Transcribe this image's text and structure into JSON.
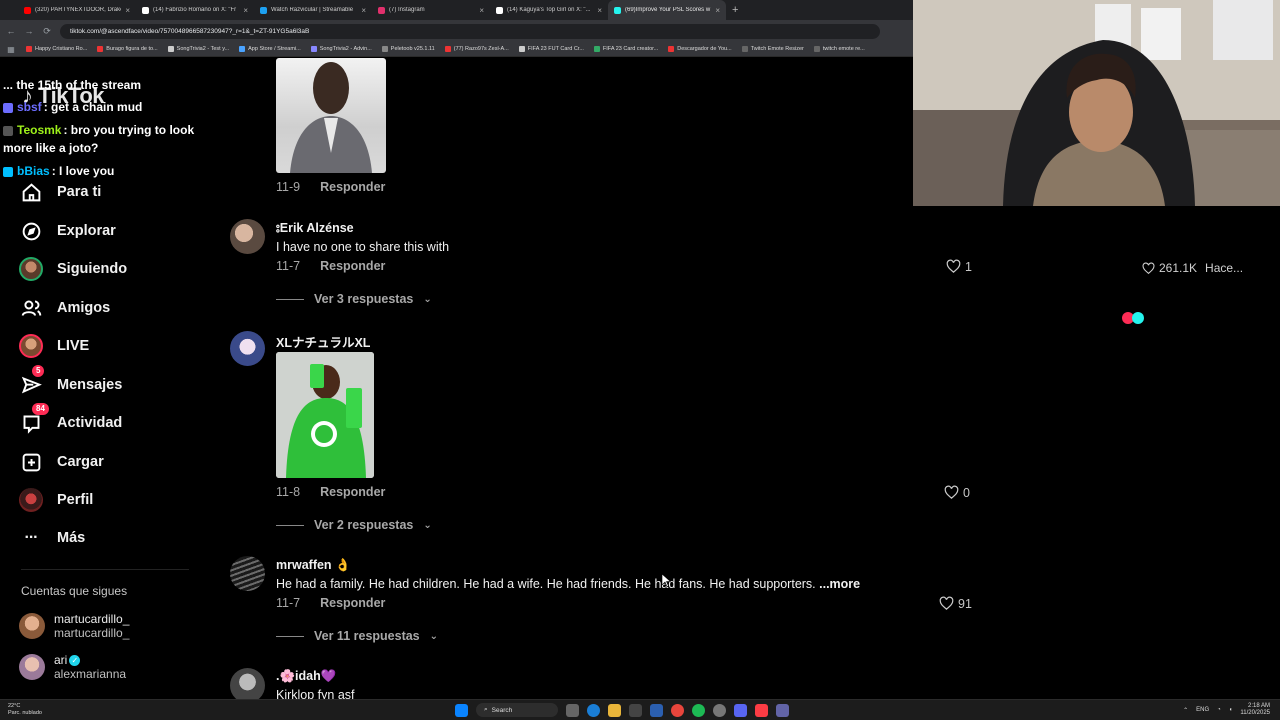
{
  "browser": {
    "tabs": [
      {
        "title": "(320) PARTYNEXTDOOR, Drake",
        "color": "#ff0000"
      },
      {
        "title": "(14) Fabrizio Romano on X: \"Fr",
        "color": "#ffffff"
      },
      {
        "title": "Watch Razvicular | Streamable",
        "color": "#1da1f2"
      },
      {
        "title": "(7) Instagram",
        "color": "#e1306c"
      },
      {
        "title": "(14) Kaguya's Top Girl on X: \"...",
        "color": "#ffffff"
      },
      {
        "title": "(69)Improve Your PSL Scores w",
        "color": "#25f4ee",
        "active": true
      }
    ],
    "new_tab": "+",
    "url": "tiktok.com/@ascendface/video/7570048966587230947?_r=1&_t=ZT-91YG5a6l3aB",
    "bookmarks": [
      "Happy Cristiano Ro...",
      "Burago figura de to...",
      "SongTrivia2 - Test y...",
      "App Store / Streami...",
      "SongTrivia2 - Advin...",
      "Peletoob v25.1.11",
      "(77) Razo97s Zesl-A...",
      "FIFA 23 FUT Card Cr...",
      "FIFA 23 Card creator...",
      "Descargador de You...",
      "Twitch Emote Resizer",
      "twitch emote re..."
    ]
  },
  "stream_chat": {
    "logo": "TikTok",
    "lines": [
      {
        "user": "",
        "text": "... the 15th of the stream",
        "color": "#ffffff"
      },
      {
        "user": "sbsf",
        "text": ": get a chain mud",
        "color": "#6d6dff"
      },
      {
        "user": "Teosmk",
        "text": ": bro you trying to look more like a joto?",
        "color": "#9ef01a"
      },
      {
        "user": "bBias",
        "text": ": I love you",
        "color": "#00bfff"
      }
    ]
  },
  "sidebar": {
    "items": [
      {
        "label": "Para ti",
        "icon": "home-icon"
      },
      {
        "label": "Explorar",
        "icon": "compass-icon"
      },
      {
        "label": "Siguiendo",
        "icon": "following-avatar-icon"
      },
      {
        "label": "Amigos",
        "icon": "friends-icon"
      },
      {
        "label": "LIVE",
        "icon": "live-avatar-icon"
      },
      {
        "label": "Mensajes",
        "icon": "messages-icon",
        "badge": "5"
      },
      {
        "label": "Actividad",
        "icon": "activity-icon",
        "badge": "84"
      },
      {
        "label": "Cargar",
        "icon": "upload-icon"
      },
      {
        "label": "Perfil",
        "icon": "profile-avatar-icon"
      },
      {
        "label": "Más",
        "icon": "more-icon"
      }
    ],
    "following_title": "Cuentas que sigues",
    "following": [
      {
        "name": "martucardillo_",
        "handle": "martucardillo_",
        "verified": false
      },
      {
        "name": "ari",
        "handle": "alexmarianna",
        "verified": true
      }
    ]
  },
  "comments": [
    {
      "id": "c0",
      "user": "",
      "text": "",
      "date": "11-9",
      "reply": "Responder",
      "likes": "",
      "has_image": true
    },
    {
      "id": "c1",
      "user": "⦂Erik Alzénse",
      "text": "I have no one to share this with",
      "date": "11-7",
      "reply": "Responder",
      "likes": "1",
      "replies": "Ver 3 respuestas"
    },
    {
      "id": "c2",
      "user": "XLナチュラルXL",
      "text": "",
      "date": "11-8",
      "reply": "Responder",
      "likes": "0",
      "replies": "Ver 2 respuestas",
      "has_image": true
    },
    {
      "id": "c3",
      "user": "mrwaffen 👌",
      "text": "He had a family. He had children. He had a wife. He had friends. He had fans. He had supporters.",
      "more": "...more",
      "date": "11-7",
      "reply": "Responder",
      "likes": "91",
      "replies": "Ver 11 respuestas"
    },
    {
      "id": "c4",
      "user": ".🌸idah💜",
      "text": "Kirklop fyn asf",
      "date": "",
      "reply": "",
      "likes": ""
    }
  ],
  "video": {
    "views": "261.1K",
    "time": "Hace..."
  },
  "taskbar": {
    "weather_temp": "22°C",
    "weather_desc": "Parc. nublado",
    "search": "Search",
    "lang": "ENG",
    "time": "2:18 AM",
    "date": "11/20/2025"
  },
  "colors": {
    "accent": "#fe2c55",
    "background": "#000000",
    "secondary_text": "#a8a8a8"
  }
}
